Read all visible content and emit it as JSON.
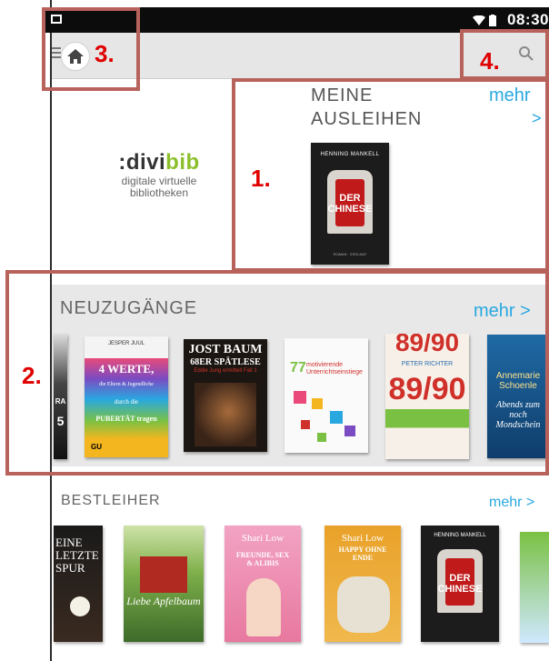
{
  "status_bar": {
    "time": "08:30"
  },
  "app_bar": {
    "menu_icon": "menu-icon",
    "home_icon": "home-icon",
    "search_icon": "search-icon"
  },
  "annotations": [
    "1.",
    "2.",
    "3.",
    "4."
  ],
  "logo": {
    "prefix": ":divi",
    "suffix": "bib",
    "line1": "digitale virtuelle",
    "line2": "bibliotheken"
  },
  "ausleihen": {
    "title_line1": "MEINE",
    "title_line2": "AUSLEIHEN",
    "more_label": "mehr",
    "more_arrow": ">",
    "books": [
      {
        "author": "HENNING MANKELL",
        "title_line1": "DER",
        "title_line2": "CHINESE",
        "footer": "ROMAN · ZSOLNAY"
      }
    ]
  },
  "neuzugaenge": {
    "title": "NEUZUGÄNGE",
    "more_label": "mehr >",
    "books": [
      {
        "lines": [
          "RA",
          "5"
        ]
      },
      {
        "author": "JESPER JUUL",
        "title": "4 WERTE,",
        "sub1": "die Eltern & Jugendliche",
        "sub2": "durch die",
        "sub3": "PUBERTÄT tragen",
        "publisher": "GU"
      },
      {
        "title_line1": "JOST BAUM",
        "title_line2": "68ER SPÄTLESE",
        "sub": "Eddie Jung ermittelt Fall 1"
      },
      {
        "number": "77",
        "title": "motivierende Unterrichtseinstiege"
      },
      {
        "top": "89/90",
        "author": "PETER RICHTER",
        "number": "89/90"
      },
      {
        "author": "Annemarie Schoenle",
        "title": "Abends zum noch Mondschein"
      }
    ]
  },
  "bestleiher": {
    "title": "BESTLEIHER",
    "more_label": "mehr >",
    "books": [
      {
        "title": "EINE LETZTE SPUR"
      },
      {
        "title": "Liebe Apfelbaum"
      },
      {
        "author": "Shari Low",
        "title": "FREUNDE, SEX & ALIBIS"
      },
      {
        "author": "Shari Low",
        "title": "HAPPY OHNE ENDE"
      },
      {
        "author": "HENNING MANKELL",
        "title_line1": "DER",
        "title_line2": "CHINESE"
      },
      {
        "title": ""
      }
    ]
  },
  "colors": {
    "accent": "#29a8e0",
    "annotation": "#e00000",
    "annotation_box": "#b8625c",
    "logo_green": "#8bbf2a"
  }
}
